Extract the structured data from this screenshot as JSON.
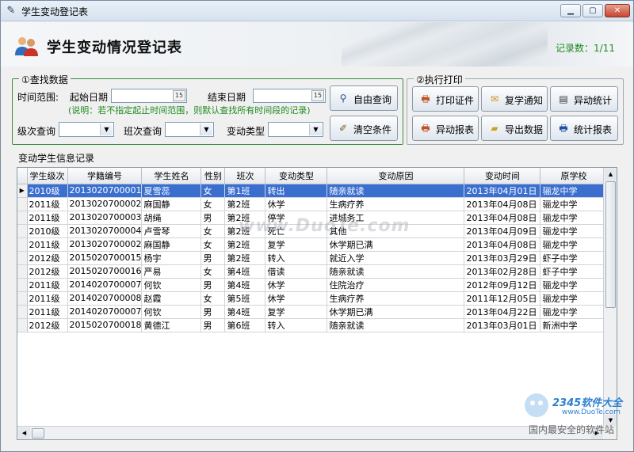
{
  "window": {
    "title": "学生变动登记表"
  },
  "banner": {
    "title": "学生变动情况登记表",
    "record_count": "记录数：1/11"
  },
  "search": {
    "group_label": "①查找数据",
    "range_label": "时间范围:",
    "start_label": "起始日期",
    "end_label": "结束日期",
    "hint": "(说明：若不指定起止时间范围，则默认查找所有时间段的记录)",
    "grade_label": "级次查询",
    "class_label": "班次查询",
    "type_label": "变动类型",
    "free_query": "自由查询",
    "clear": "清空条件"
  },
  "print": {
    "group_label": "②执行打印",
    "buttons": [
      "打印证件",
      "复学通知",
      "异动统计",
      "异动报表",
      "导出数据",
      "统计报表"
    ]
  },
  "records": {
    "label": "变动学生信息记录",
    "columns": [
      "学生级次",
      "学籍编号",
      "学生姓名",
      "性别",
      "班次",
      "变动类型",
      "变动原因",
      "变动时间",
      "原学校"
    ],
    "rows": [
      [
        "2010级",
        "2013020700001",
        "夏雪蕊",
        "女",
        "第1班",
        "转出",
        "随亲就读",
        "2013年04月01日",
        "骊龙中学"
      ],
      [
        "2011级",
        "2013020700002",
        "麻国静",
        "女",
        "第2班",
        "休学",
        "生病疗养",
        "2013年04月08日",
        "骊龙中学"
      ],
      [
        "2011级",
        "2013020700003",
        "胡绳",
        "男",
        "第2班",
        "停学",
        "进城务工",
        "2013年04月08日",
        "骊龙中学"
      ],
      [
        "2010级",
        "2013020700004",
        "卢雪琴",
        "女",
        "第2班",
        "死亡",
        "其他",
        "2013年04月09日",
        "骊龙中学"
      ],
      [
        "2011级",
        "2013020700002",
        "麻国静",
        "女",
        "第2班",
        "复学",
        "休学期已满",
        "2013年04月08日",
        "骊龙中学"
      ],
      [
        "2012级",
        "2015020700015",
        "杨宇",
        "男",
        "第2班",
        "转入",
        "就近入学",
        "2013年03月29日",
        "虾子中学"
      ],
      [
        "2012级",
        "2015020700016",
        "严易",
        "女",
        "第4班",
        "借读",
        "随亲就读",
        "2013年02月28日",
        "虾子中学"
      ],
      [
        "2011级",
        "2014020700007",
        "何钦",
        "男",
        "第4班",
        "休学",
        "住院治疗",
        "2012年09月12日",
        "骊龙中学"
      ],
      [
        "2011级",
        "2014020700008",
        "赵霞",
        "女",
        "第5班",
        "休学",
        "生病疗养",
        "2011年12月05日",
        "骊龙中学"
      ],
      [
        "2011级",
        "2014020700007",
        "何钦",
        "男",
        "第4班",
        "复学",
        "休学期已满",
        "2013年04月22日",
        "骊龙中学"
      ],
      [
        "2012级",
        "2015020700018",
        "黄德江",
        "男",
        "第6班",
        "转入",
        "随亲就读",
        "2013年03月01日",
        "新洲中学"
      ]
    ]
  },
  "watermark": {
    "site": "www.DuoTe.com",
    "brand": "2345软件大全",
    "brand_url": "www.DuoTe.com",
    "slogan": "国内最安全的软件站"
  }
}
